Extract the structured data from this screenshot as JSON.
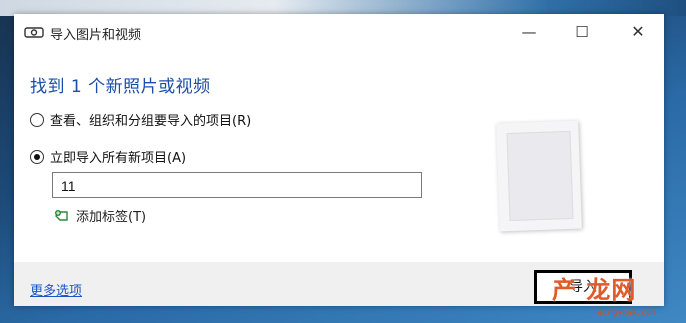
{
  "window": {
    "title": "导入图片和视频",
    "minimize_icon": "minimize-icon",
    "maximize_icon": "maximize-icon",
    "close_icon": "close-icon"
  },
  "main": {
    "heading": "找到 1 个新照片或视频",
    "options": [
      {
        "label": "查看、组织和分组要导入的项目(R)",
        "selected": false
      },
      {
        "label": "立即导入所有新项目(A)",
        "selected": true
      }
    ],
    "name_input": {
      "value": "11"
    },
    "add_tag": {
      "label": "添加标签(T)",
      "icon": "tag-add-icon"
    }
  },
  "footer": {
    "more_options": "更多选项",
    "import_button": "导入"
  },
  "watermark": {
    "text": "产 龙网",
    "sub": "mingyonk.com"
  },
  "colors": {
    "heading": "#1a4fa8",
    "link": "#1a55c4",
    "watermark": "#e05a2a"
  }
}
